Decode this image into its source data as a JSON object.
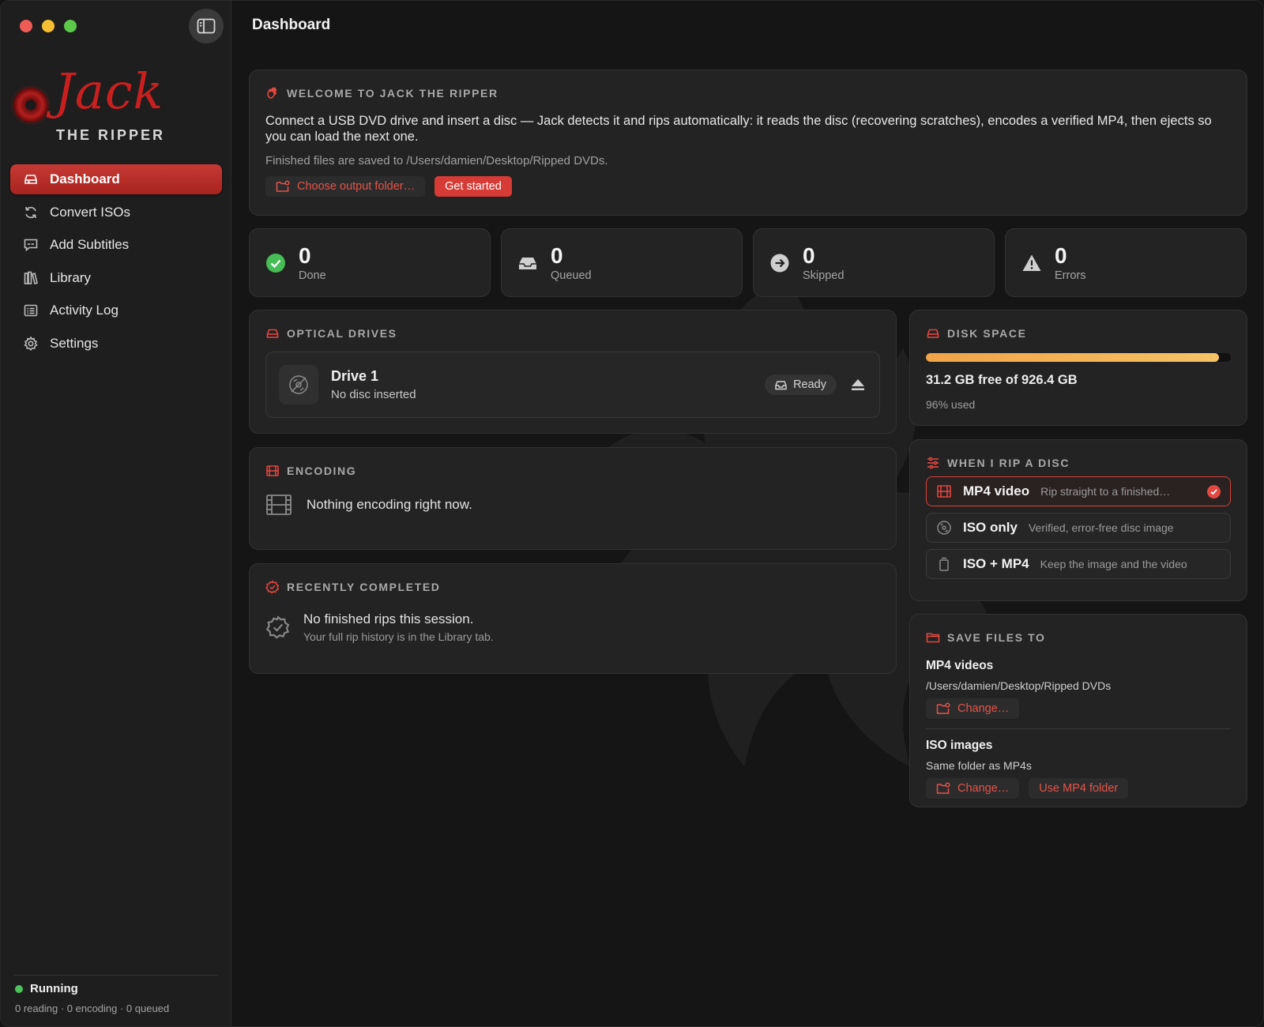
{
  "app": {
    "logo_top": "Jack",
    "logo_bottom": "THE RIPPER"
  },
  "sidebar": {
    "items": [
      {
        "label": "Dashboard",
        "icon": "drive-icon",
        "active": true
      },
      {
        "label": "Convert ISOs",
        "icon": "refresh-icon"
      },
      {
        "label": "Add Subtitles",
        "icon": "subtitle-icon"
      },
      {
        "label": "Library",
        "icon": "library-icon"
      },
      {
        "label": "Activity Log",
        "icon": "log-icon"
      },
      {
        "label": "Settings",
        "icon": "gear-icon"
      }
    ],
    "status": {
      "label": "Running",
      "detail": "0 reading · 0 encoding · 0 queued"
    }
  },
  "header": {
    "title": "Dashboard"
  },
  "welcome": {
    "heading": "WELCOME TO JACK THE RIPPER",
    "text": "Connect a USB DVD drive and insert a disc — Jack detects it and rips automatically: it reads the disc (recovering scratches), encodes a verified MP4, then ejects so you can load the next one.",
    "note": "Finished files are saved to /Users/damien/Desktop/Ripped DVDs.",
    "choose_folder": "Choose output folder…",
    "get_started": "Get started"
  },
  "stats": [
    {
      "value": "0",
      "label": "Done"
    },
    {
      "value": "0",
      "label": "Queued"
    },
    {
      "value": "0",
      "label": "Skipped"
    },
    {
      "value": "0",
      "label": "Errors"
    }
  ],
  "drives": {
    "heading": "OPTICAL DRIVES",
    "items": [
      {
        "name": "Drive 1",
        "status": "No disc inserted",
        "state": "Ready"
      }
    ]
  },
  "disk": {
    "heading": "DISK SPACE",
    "free_text": "31.2 GB free of 926.4 GB",
    "used_text": "96% used",
    "used_fraction": 0.96
  },
  "encoding": {
    "heading": "ENCODING",
    "empty": "Nothing encoding right now."
  },
  "rip": {
    "heading": "WHEN I RIP A DISC",
    "options": [
      {
        "title": "MP4 video",
        "desc": "Rip straight to a finished…",
        "selected": true
      },
      {
        "title": "ISO only",
        "desc": "Verified, error-free disc image"
      },
      {
        "title": "ISO + MP4",
        "desc": "Keep the image and the video"
      }
    ]
  },
  "recent": {
    "heading": "RECENTLY COMPLETED",
    "empty": "No finished rips this session.",
    "hint": "Your full rip history is in the Library tab."
  },
  "save": {
    "heading": "SAVE FILES TO",
    "mp4_label": "MP4 videos",
    "mp4_path": "/Users/damien/Desktop/Ripped DVDs",
    "iso_label": "ISO images",
    "iso_path": "Same folder as MP4s",
    "change": "Change…",
    "use_mp4": "Use MP4 folder"
  },
  "colors": {
    "accent": "#d63b35",
    "success": "#4cc35a",
    "disk_bar": "#f2a348"
  }
}
